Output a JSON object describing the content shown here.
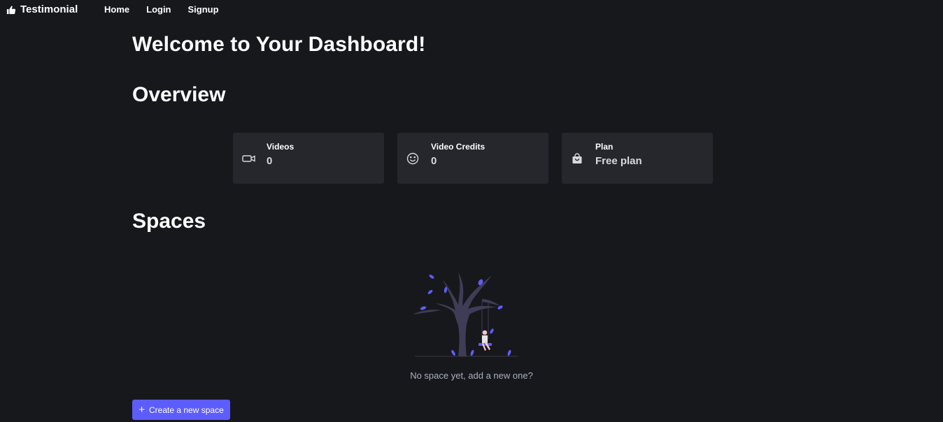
{
  "brand": {
    "name": "Testimonial",
    "icon": "thumbs-up-icon"
  },
  "nav": {
    "home": "Home",
    "login": "Login",
    "signup": "Signup"
  },
  "page": {
    "welcome": "Welcome to Your Dashboard!",
    "overview_title": "Overview",
    "spaces_title": "Spaces"
  },
  "stats": [
    {
      "label": "Videos",
      "value": "0",
      "icon": "video-camera-icon"
    },
    {
      "label": "Video Credits",
      "value": "0",
      "icon": "smiley-icon"
    },
    {
      "label": "Plan",
      "value": "Free plan",
      "icon": "shopping-bag-icon"
    }
  ],
  "spaces": {
    "empty_message": "No space yet, add a new one?",
    "create_button": "Create a new space"
  },
  "colors": {
    "background": "#17181c",
    "card": "#25272d",
    "accent": "#5d5dff",
    "muted_text": "#a8b1c2"
  }
}
